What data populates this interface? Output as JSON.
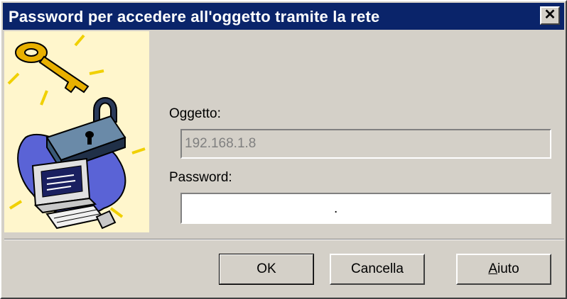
{
  "window": {
    "title": "Password per accedere all'oggetto tramite la rete",
    "close_label": "✕"
  },
  "form": {
    "object_label": "Oggetto:",
    "object_value": "192.168.1.8",
    "password_label": "Password:",
    "password_value": "."
  },
  "buttons": {
    "ok": "OK",
    "cancel": "Cancella",
    "help_mnemonic": "A",
    "help_rest": "iuto"
  },
  "colors": {
    "titlebar": "#0a246a",
    "dialog": "#d4d0c8"
  },
  "icons": {
    "illustration": "key-padlock-computer-illustration",
    "close": "close-icon"
  }
}
